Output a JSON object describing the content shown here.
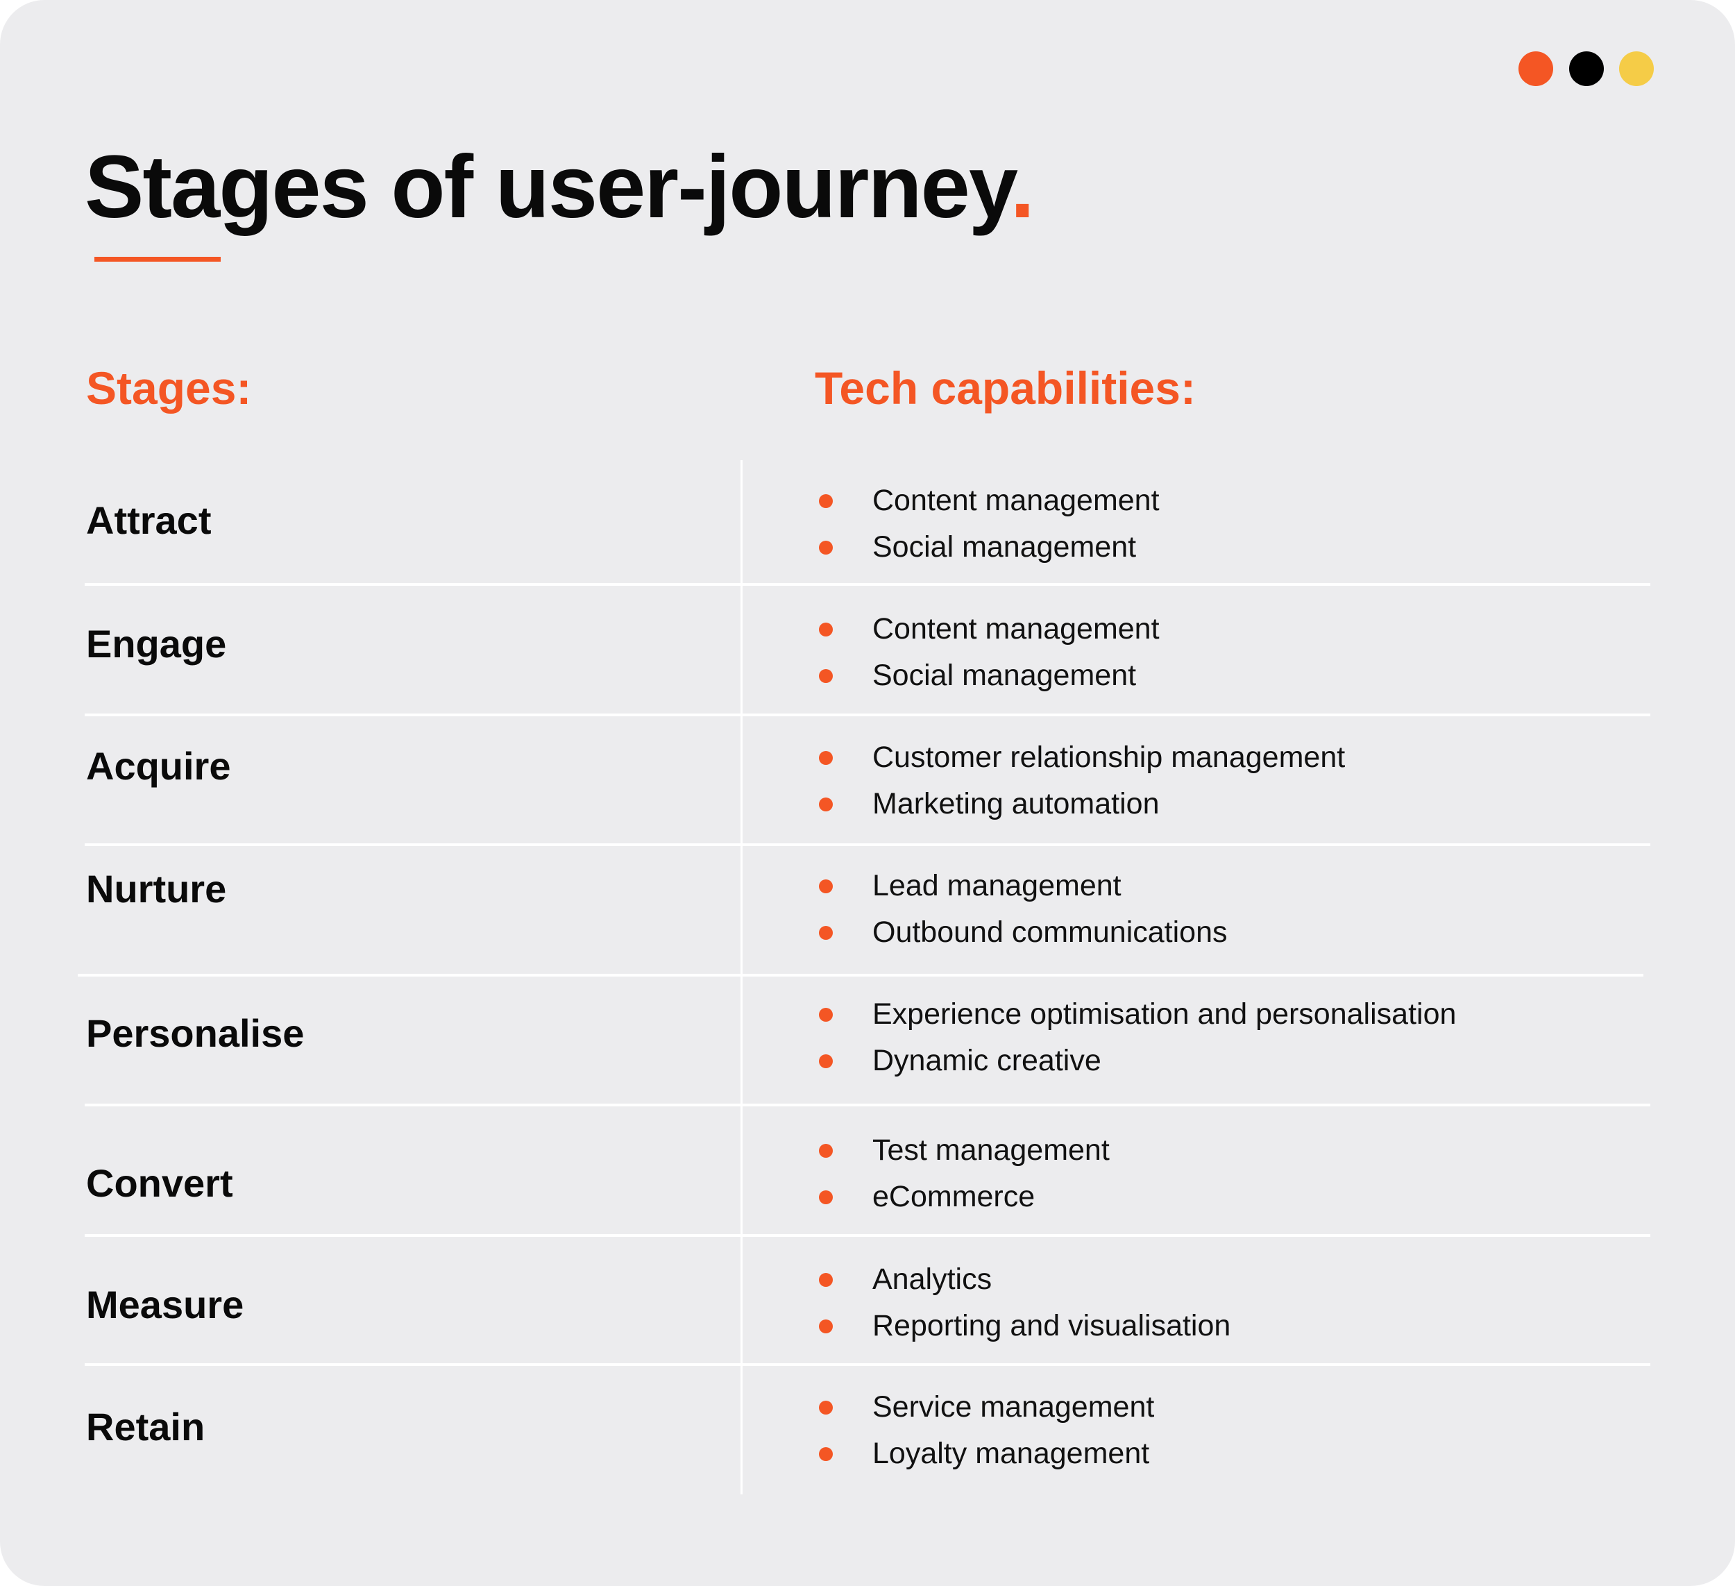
{
  "colors": {
    "accent": "#f45624",
    "black": "#000000",
    "yellow": "#f5cc47",
    "background": "#ececee"
  },
  "window_dots": [
    {
      "name": "orange-dot",
      "color": "#f45624"
    },
    {
      "name": "black-dot",
      "color": "#000000"
    },
    {
      "name": "yellow-dot",
      "color": "#f5cc47"
    }
  ],
  "title": {
    "text": "Stages of user-journey",
    "accent_char": "."
  },
  "headers": {
    "stages": "Stages:",
    "capabilities": "Tech capabilities:"
  },
  "rows": [
    {
      "stage": "Attract",
      "capabilities": [
        "Content management",
        "Social management"
      ]
    },
    {
      "stage": "Engage",
      "capabilities": [
        "Content management",
        "Social management"
      ]
    },
    {
      "stage": "Acquire",
      "capabilities": [
        "Customer relationship management",
        "Marketing automation"
      ]
    },
    {
      "stage": "Nurture",
      "capabilities": [
        "Lead management",
        "Outbound communications"
      ]
    },
    {
      "stage": "Personalise",
      "capabilities": [
        "Experience optimisation and personalisation",
        "Dynamic creative"
      ]
    },
    {
      "stage": "Convert",
      "capabilities": [
        "Test management",
        "eCommerce"
      ]
    },
    {
      "stage": "Measure",
      "capabilities": [
        "Analytics",
        "Reporting and visualisation"
      ]
    },
    {
      "stage": "Retain",
      "capabilities": [
        "Service management",
        "Loyalty management"
      ]
    }
  ]
}
